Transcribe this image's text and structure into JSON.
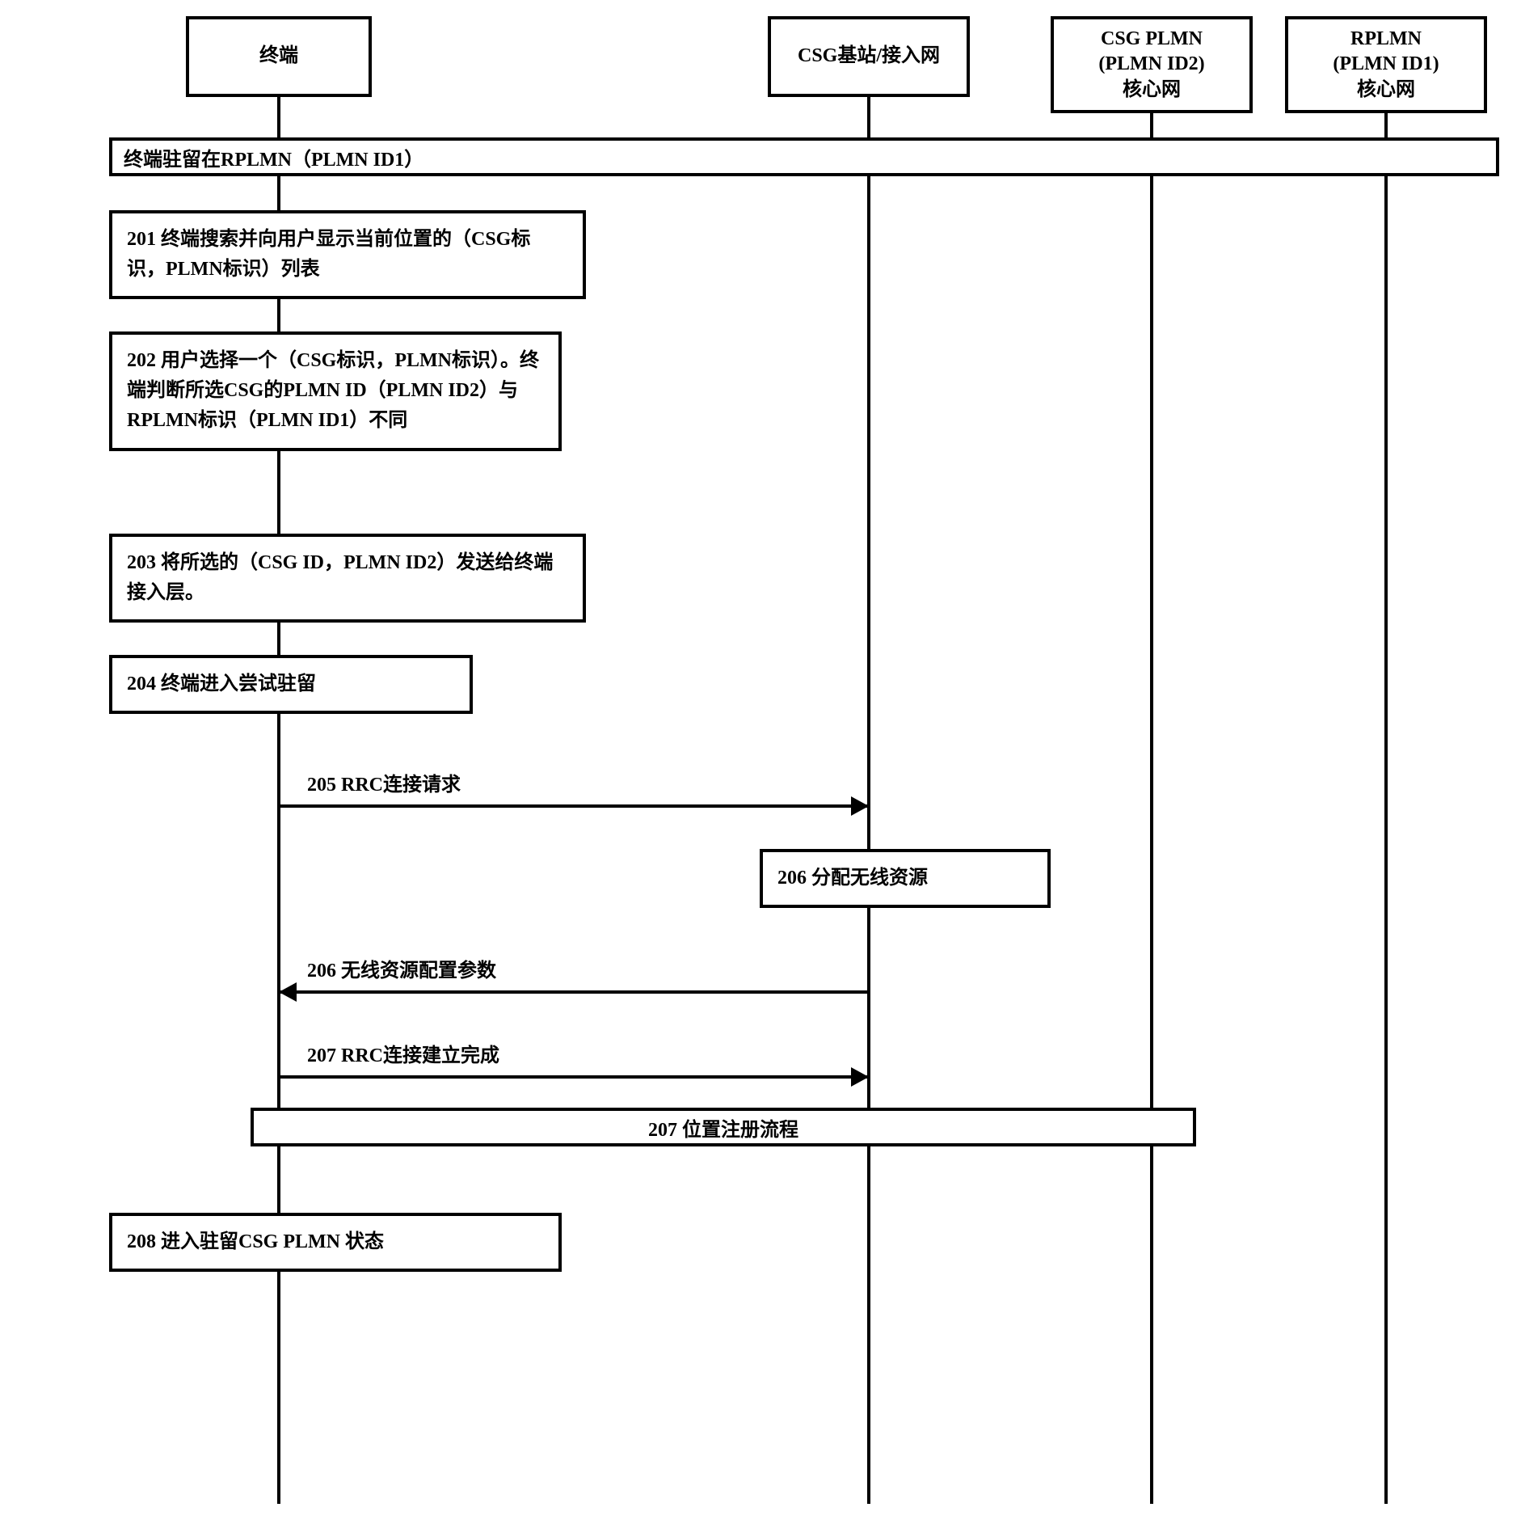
{
  "participants": {
    "terminal": "终端",
    "csg_bs": "CSG基站/接入网",
    "csg_plmn": "CSG PLMN\n(PLMN ID2)\n核心网",
    "rplmn": "RPLMN\n(PLMN ID1)\n核心网"
  },
  "span_camp": "终端驻留在RPLMN（PLMN ID1）",
  "steps": {
    "s201": "201 终端搜索并向用户显示当前位置的（CSG标识，PLMN标识）列表",
    "s202": "202 用户选择一个（CSG标识，PLMN标识）。终端判断所选CSG的PLMN ID（PLMN ID2）与RPLMN标识（PLMN ID1）不同",
    "s203": "203  将所选的（CSG ID，PLMN ID2）发送给终端接入层。",
    "s204": "204 终端进入尝试驻留",
    "s206box": "206  分配无线资源",
    "s208": "208  进入驻留CSG PLMN 状态"
  },
  "messages": {
    "m205": "205 RRC连接请求",
    "m206": "206 无线资源配置参数",
    "m207a": "207 RRC连接建立完成",
    "m207b": "207  位置注册流程"
  }
}
